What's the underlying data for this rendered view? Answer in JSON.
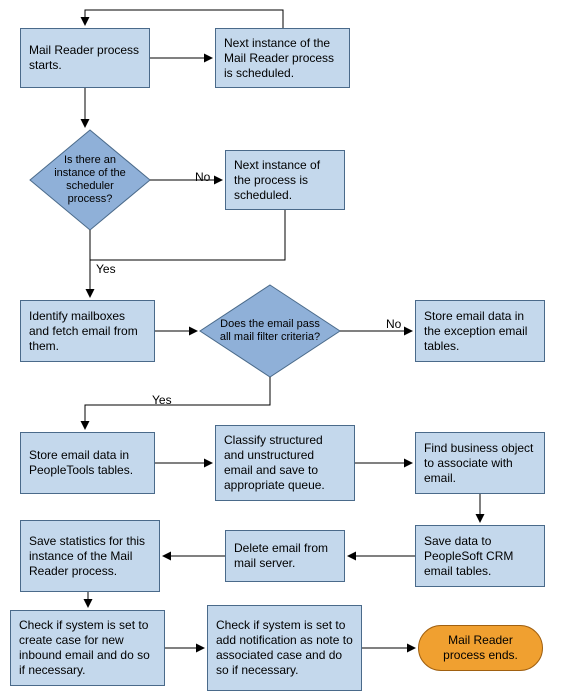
{
  "chart_data": {
    "type": "flowchart",
    "nodes": [
      {
        "id": "start",
        "type": "process",
        "text": "Mail Reader process starts."
      },
      {
        "id": "sched1",
        "type": "process",
        "text": "Next instance of the Mail Reader process is scheduled."
      },
      {
        "id": "d1",
        "type": "decision",
        "text": "Is there an instance of the scheduler process?"
      },
      {
        "id": "sched2",
        "type": "process",
        "text": "Next instance of the process is scheduled."
      },
      {
        "id": "fetch",
        "type": "process",
        "text": "Identify mailboxes and fetch email from them."
      },
      {
        "id": "d2",
        "type": "decision",
        "text": "Does the email pass all mail filter criteria?"
      },
      {
        "id": "exc",
        "type": "process",
        "text": "Store email data in the exception email tables."
      },
      {
        "id": "store",
        "type": "process",
        "text": "Store email data in PeopleTools tables."
      },
      {
        "id": "classify",
        "type": "process",
        "text": "Classify structured and unstructured email and save to appropriate queue."
      },
      {
        "id": "find",
        "type": "process",
        "text": "Find business object to associate with email."
      },
      {
        "id": "crm",
        "type": "process",
        "text": "Save data to PeopleSoft CRM email tables."
      },
      {
        "id": "delete",
        "type": "process",
        "text": "Delete email from mail server."
      },
      {
        "id": "stats",
        "type": "process",
        "text": "Save statistics for this instance of the Mail Reader process."
      },
      {
        "id": "createcase",
        "type": "process",
        "text": "Check if system is set to create case for new inbound email and do so if necessary."
      },
      {
        "id": "addnote",
        "type": "process",
        "text": "Check if system is set to add notification as note to associated case and do so if necessary."
      },
      {
        "id": "end",
        "type": "terminator",
        "text": "Mail Reader process ends."
      }
    ],
    "edges": [
      {
        "from": "start",
        "to": "sched1"
      },
      {
        "from": "sched1",
        "to": "start",
        "note": "loop back"
      },
      {
        "from": "start",
        "to": "d1"
      },
      {
        "from": "d1",
        "to": "sched2",
        "label": "No"
      },
      {
        "from": "d1",
        "to": "fetch",
        "label": "Yes"
      },
      {
        "from": "sched2",
        "to": "fetch"
      },
      {
        "from": "fetch",
        "to": "d2"
      },
      {
        "from": "d2",
        "to": "exc",
        "label": "No"
      },
      {
        "from": "d2",
        "to": "store",
        "label": "Yes"
      },
      {
        "from": "store",
        "to": "classify"
      },
      {
        "from": "classify",
        "to": "find"
      },
      {
        "from": "find",
        "to": "crm"
      },
      {
        "from": "crm",
        "to": "delete"
      },
      {
        "from": "delete",
        "to": "stats"
      },
      {
        "from": "stats",
        "to": "createcase"
      },
      {
        "from": "createcase",
        "to": "addnote"
      },
      {
        "from": "addnote",
        "to": "end"
      }
    ]
  },
  "labels": {
    "no": "No",
    "yes": "Yes"
  },
  "nodes": {
    "start": "Mail Reader process starts.",
    "sched1": "Next instance of the Mail Reader process is scheduled.",
    "d1": "Is there an instance of the scheduler process?",
    "sched2": "Next instance of the process is scheduled.",
    "fetch": "Identify mailboxes and fetch email from them.",
    "d2": "Does the email pass all mail filter criteria?",
    "exc": "Store email data in the exception email tables.",
    "store": "Store email data in PeopleTools tables.",
    "classify": "Classify structured and unstructured email and save to appropriate queue.",
    "find": "Find business object to associate with email.",
    "crm": "Save data to PeopleSoft CRM email tables.",
    "delete": "Delete email from mail server.",
    "stats": "Save statistics for this instance of the Mail Reader process.",
    "createcase": "Check if system is set to create case for new inbound email and do so if necessary.",
    "addnote": "Check if system is set to add notification as note to associated case and do so if necessary.",
    "end": "Mail Reader process ends."
  }
}
